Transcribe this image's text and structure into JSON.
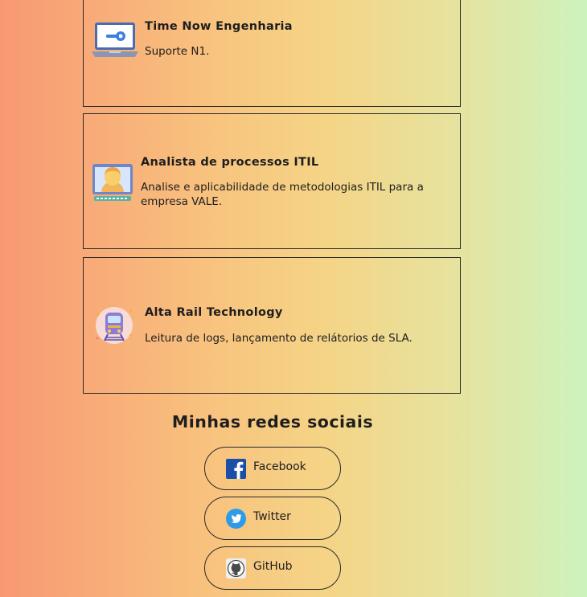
{
  "experiences": [
    {
      "title": "Time Now Engenharia",
      "description": "Suporte N1.",
      "icon": "laptop-wrench-icon"
    },
    {
      "title": "Analista de processos ITIL",
      "description": "Analise e aplicabilidade de metodologias ITIL para a empresa VALE.",
      "icon": "monitor-person-icon"
    },
    {
      "title": "Alta Rail Technology",
      "description": "Leitura de logs, lançamento de relátorios de SLA.",
      "icon": "train-icon"
    }
  ],
  "social": {
    "heading": "Minhas redes sociais",
    "links": [
      {
        "label": "Facebook",
        "icon": "facebook-icon"
      },
      {
        "label": "Twitter",
        "icon": "twitter-icon"
      },
      {
        "label": "GitHub",
        "icon": "github-icon"
      }
    ]
  },
  "colors": {
    "facebook": "#1a4fa8",
    "twitter": "#2f9be8",
    "border": "#2a2a2a"
  }
}
